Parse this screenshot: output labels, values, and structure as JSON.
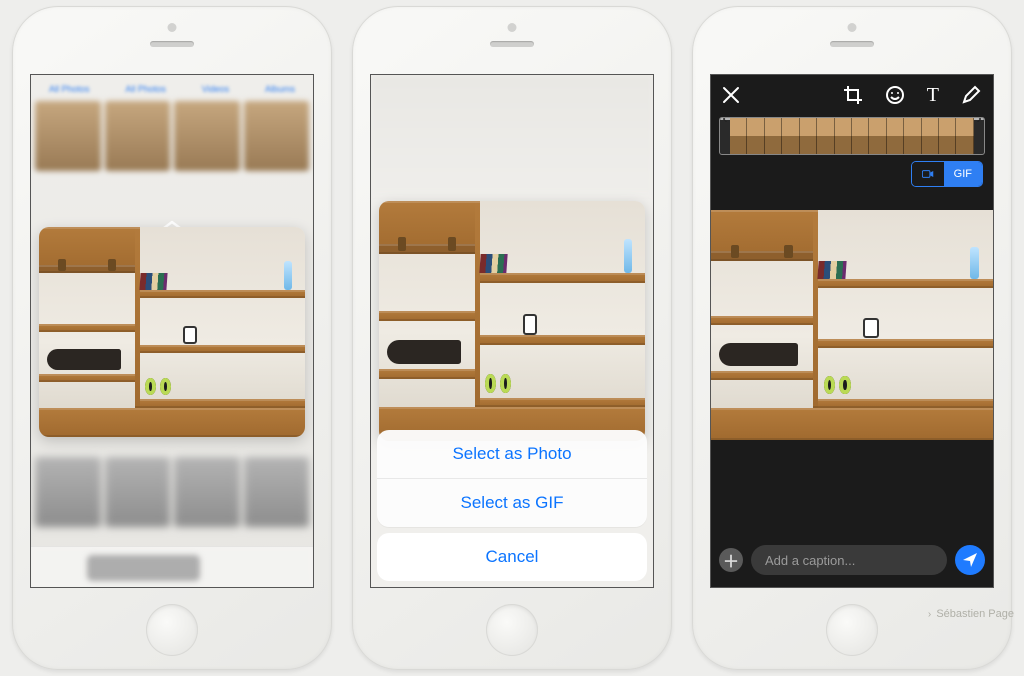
{
  "attribution": "Sébastien Page",
  "screen1": {
    "tabs": [
      "All Photos",
      "All Photos",
      "Videos",
      "Albums"
    ]
  },
  "screen2": {
    "action_sheet": {
      "option_photo": "Select as Photo",
      "option_gif": "Select as GIF",
      "cancel": "Cancel"
    }
  },
  "screen3": {
    "close_icon": "close-icon",
    "tools": {
      "crop": "crop-icon",
      "emoji": "emoji-icon",
      "text_label": "T",
      "draw": "pencil-icon"
    },
    "segmented": {
      "video_icon": "video-icon",
      "gif_label": "GIF",
      "active": "gif"
    },
    "caption_placeholder": "Add a caption...",
    "filmstrip_frames": 14
  }
}
